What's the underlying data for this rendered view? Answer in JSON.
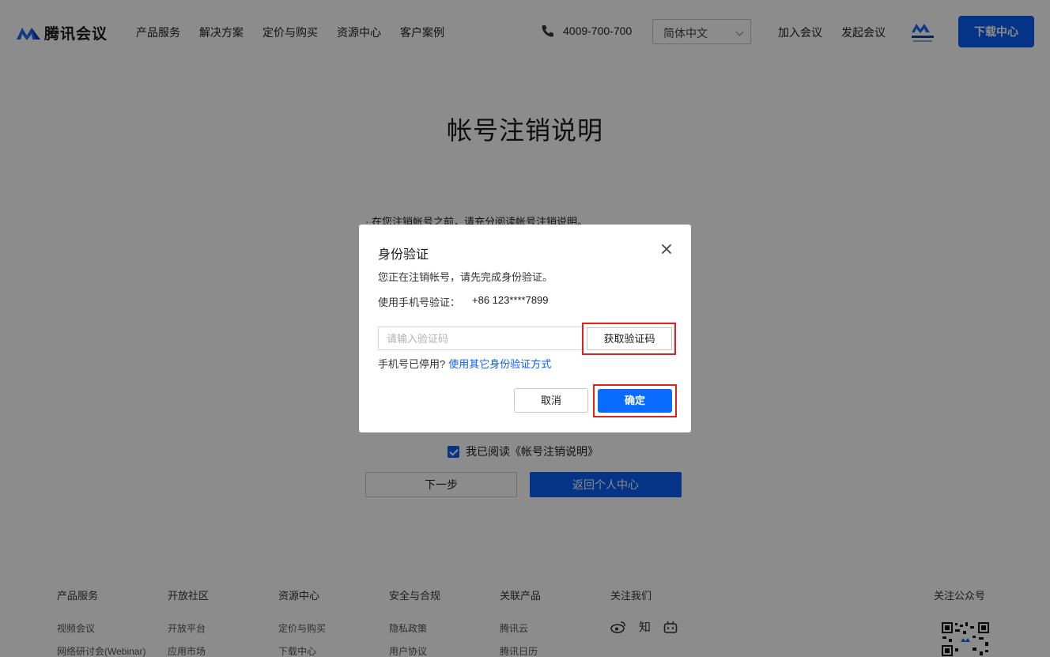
{
  "header": {
    "brand": "腾讯会议",
    "nav": [
      "产品服务",
      "解决方案",
      "定价与购买",
      "资源中心",
      "客户案例"
    ],
    "phone": "4009-700-700",
    "language": "简体中文",
    "join_label": "加入会议",
    "start_label": "发起会议",
    "download_label": "下载中心",
    "brand_color": "#0a5ef5"
  },
  "page": {
    "title": "帐号注销说明",
    "notice": "· 在您注销帐号之前，请充分阅读帐号注销说明。",
    "agree_label": "我已阅读《帐号注销说明》",
    "agree_checked": true,
    "next_label": "下一步",
    "back_label": "返回个人中心"
  },
  "footer": {
    "columns": [
      {
        "heading": "产品服务",
        "items": [
          "视频会议",
          "网络研讨会(Webinar)"
        ]
      },
      {
        "heading": "开放社区",
        "items": [
          "开放平台",
          "应用市场"
        ]
      },
      {
        "heading": "资源中心",
        "items": [
          "定价与购买",
          "下载中心"
        ]
      },
      {
        "heading": "安全与合规",
        "items": [
          "隐私政策",
          "用户协议"
        ]
      },
      {
        "heading": "关联产品",
        "items": [
          "腾讯云",
          "腾讯日历"
        ]
      }
    ],
    "follow_heading": "关注我们",
    "social_icons": [
      "weibo-icon",
      "zhihu-icon",
      "bilibili-icon"
    ],
    "zhihu_glyph": "知",
    "qr_heading": "关注公众号"
  },
  "dialog": {
    "title": "身份验证",
    "description": "您正在注销帐号，请先完成身份验证。",
    "phone_label": "使用手机号验证：",
    "phone_value": "+86 123****7899",
    "code_placeholder": "请输入验证码",
    "get_code_label": "获取验证码",
    "alt_prefix": "手机号已停用?",
    "alt_link": "使用其它身份验证方式",
    "cancel_label": "取消",
    "confirm_label": "确定",
    "highlight_color": "#e02020"
  }
}
